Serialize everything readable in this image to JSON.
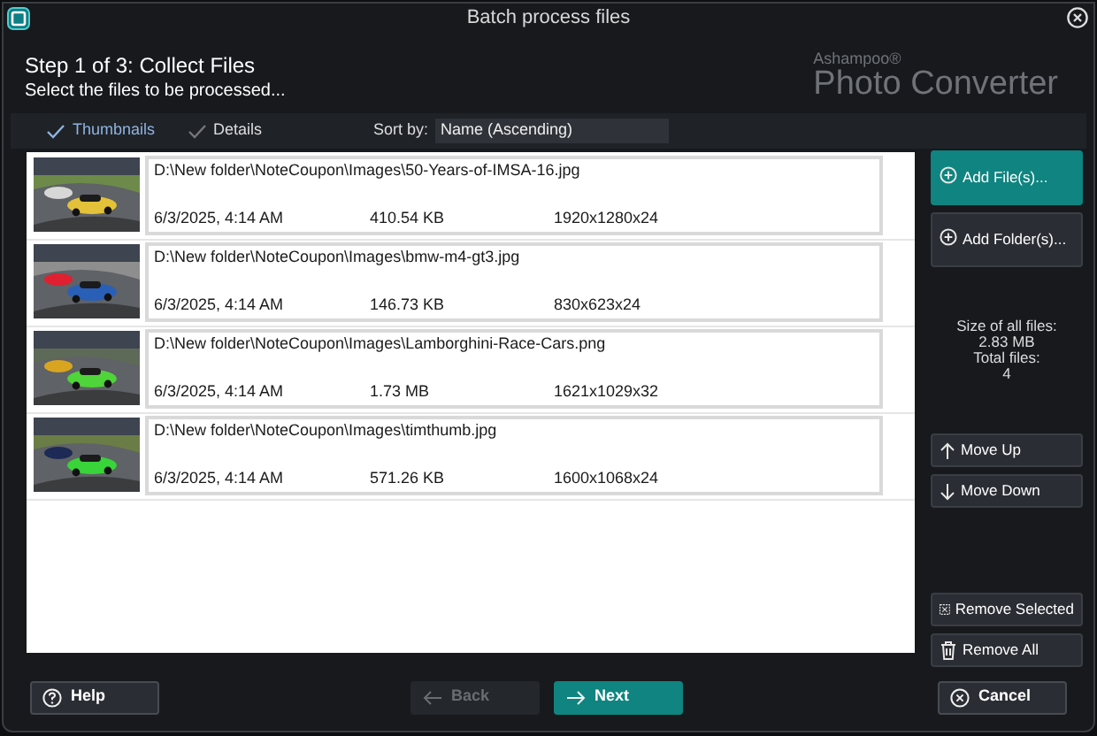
{
  "window": {
    "title": "Batch process files"
  },
  "header": {
    "step": "Step 1 of 3: Collect Files",
    "instruction": "Select the files to be processed...",
    "brand": "Ashampoo®",
    "product": "Photo Converter"
  },
  "view_tabs": [
    {
      "label": "Thumbnails",
      "selected": true
    },
    {
      "label": "Details",
      "selected": false
    }
  ],
  "sort": {
    "label": "Sort by:",
    "value": "Name (Ascending)"
  },
  "files": [
    {
      "path": "D:\\New folder\\NoteCoupon\\Images\\50-Years-of-IMSA-16.jpg",
      "date": "6/3/2025, 4:14 AM",
      "size": "410.54 KB",
      "dimensions": "1920x1280x24"
    },
    {
      "path": "D:\\New folder\\NoteCoupon\\Images\\bmw-m4-gt3.jpg",
      "date": "6/3/2025, 4:14 AM",
      "size": "146.73 KB",
      "dimensions": "830x623x24"
    },
    {
      "path": "D:\\New folder\\NoteCoupon\\Images\\Lamborghini-Race-Cars.png",
      "date": "6/3/2025, 4:14 AM",
      "size": "1.73 MB",
      "dimensions": "1621x1029x32"
    },
    {
      "path": "D:\\New folder\\NoteCoupon\\Images\\timthumb.jpg",
      "date": "6/3/2025, 4:14 AM",
      "size": "571.26 KB",
      "dimensions": "1600x1068x24"
    }
  ],
  "side_buttons": [
    {
      "label": "Add File(s)...",
      "kind": "plus",
      "primary": true
    },
    {
      "label": "Add Folder(s)...",
      "kind": "plus",
      "primary": false
    }
  ],
  "summary": [
    "Size of all files:",
    "2.83 MB",
    "Total files:",
    "4"
  ],
  "move_buttons": [
    {
      "label": "Move Up",
      "kind": "up"
    },
    {
      "label": "Move Down",
      "kind": "down"
    }
  ],
  "remove_buttons": [
    {
      "label": "Remove Selected",
      "kind": "remove-selected"
    },
    {
      "label": "Remove All",
      "kind": "trash"
    }
  ],
  "footer": [
    {
      "label": "Help",
      "kind": "help",
      "primary": false,
      "disabled": false
    },
    {
      "label": "Back",
      "kind": "back",
      "primary": false,
      "disabled": true
    },
    {
      "label": "Next",
      "kind": "next",
      "primary": true,
      "disabled": false
    },
    {
      "label": "Cancel",
      "kind": "cancel",
      "primary": false,
      "disabled": false
    }
  ]
}
